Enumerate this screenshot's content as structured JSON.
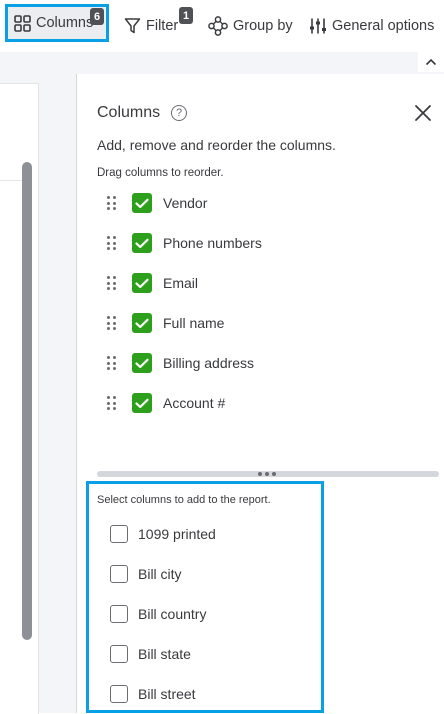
{
  "toolbar": {
    "columns_label": "Columns",
    "columns_count": "6",
    "filter_label": "Filter",
    "filter_count": "1",
    "group_label": "Group by",
    "general_label": "General options"
  },
  "panel": {
    "title": "Columns",
    "help_glyph": "?",
    "description": "Add, remove and reorder the columns.",
    "drag_hint": "Drag columns to reorder.",
    "selected_columns": [
      {
        "label": "Vendor",
        "checked": true
      },
      {
        "label": "Phone numbers",
        "checked": true
      },
      {
        "label": "Email",
        "checked": true
      },
      {
        "label": "Full name",
        "checked": true
      },
      {
        "label": "Billing address",
        "checked": true
      },
      {
        "label": "Account #",
        "checked": true
      }
    ],
    "available_hint": "Select columns to add to the report.",
    "available_columns": [
      {
        "label": "1099 printed",
        "checked": false
      },
      {
        "label": "Bill city",
        "checked": false
      },
      {
        "label": "Bill country",
        "checked": false
      },
      {
        "label": "Bill state",
        "checked": false
      },
      {
        "label": "Bill street",
        "checked": false
      }
    ]
  },
  "icons": {
    "columns": "grid-icon",
    "filter": "funnel-icon",
    "group": "group-nodes-icon",
    "general": "sliders-icon",
    "collapse": "chevron-up-icon",
    "close": "close-icon",
    "help": "help-icon",
    "check": "check-icon",
    "drag": "drag-handle-icon"
  },
  "colors": {
    "accent_highlight": "#0aa0e6",
    "checkbox_checked": "#2ca01c",
    "badge": "#4f5156",
    "text": "#393a3d"
  }
}
